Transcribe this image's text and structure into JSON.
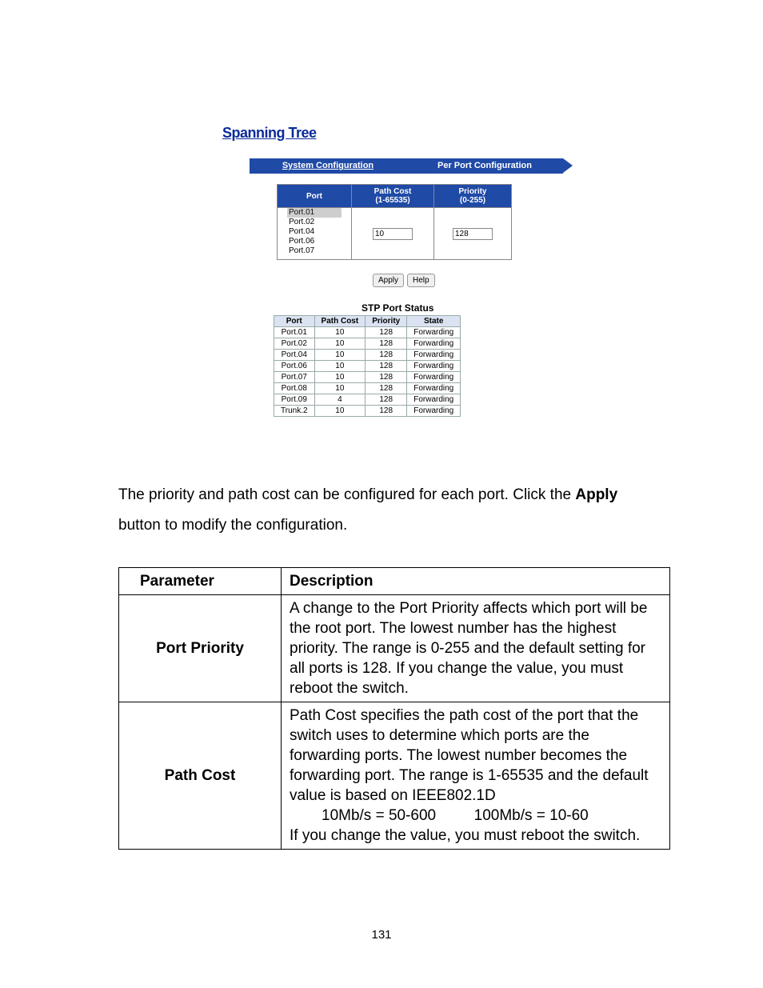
{
  "screenshot": {
    "title": "Spanning Tree",
    "tabs": {
      "system": "System Configuration",
      "per_port": "Per Port Configuration"
    },
    "config": {
      "headers": {
        "port": "Port",
        "path_cost": "Path Cost",
        "path_cost_range": "(1-65535)",
        "priority": "Priority",
        "priority_range": "(0-255)"
      },
      "port_options": [
        "Port.01",
        "Port.02",
        "Port.04",
        "Port.06",
        "Port.07"
      ],
      "path_cost_value": "10",
      "priority_value": "128"
    },
    "buttons": {
      "apply": "Apply",
      "help": "Help"
    },
    "status": {
      "title": "STP Port Status",
      "headers": {
        "port": "Port",
        "path_cost": "Path Cost",
        "priority": "Priority",
        "state": "State"
      },
      "rows": [
        {
          "port": "Port.01",
          "path_cost": "10",
          "priority": "128",
          "state": "Forwarding"
        },
        {
          "port": "Port.02",
          "path_cost": "10",
          "priority": "128",
          "state": "Forwarding"
        },
        {
          "port": "Port.04",
          "path_cost": "10",
          "priority": "128",
          "state": "Forwarding"
        },
        {
          "port": "Port.06",
          "path_cost": "10",
          "priority": "128",
          "state": "Forwarding"
        },
        {
          "port": "Port.07",
          "path_cost": "10",
          "priority": "128",
          "state": "Forwarding"
        },
        {
          "port": "Port.08",
          "path_cost": "10",
          "priority": "128",
          "state": "Forwarding"
        },
        {
          "port": "Port.09",
          "path_cost": "4",
          "priority": "128",
          "state": "Forwarding"
        },
        {
          "port": "Trunk.2",
          "path_cost": "10",
          "priority": "128",
          "state": "Forwarding"
        }
      ]
    }
  },
  "body_text": {
    "part1": "The priority and path cost can be configured for each port.   Click the ",
    "apply_bold": "Apply",
    "part2": " button to modify the configuration."
  },
  "desc_table": {
    "headers": {
      "parameter": "Parameter",
      "description": "Description"
    },
    "rows": [
      {
        "param": "Port Priority",
        "desc": "A change to the Port Priority affects which port will be the root port. The lowest number has the highest priority. The range is 0-255 and the default setting for all ports is 128.   If you change the value, you must reboot the switch."
      },
      {
        "param": "Path Cost",
        "desc_line1": "Path Cost specifies the path cost of the port that the switch uses to determine which ports are the forwarding ports.   The lowest number becomes the forwarding port.   The range is 1-65535 and the default value is based on IEEE802.1D",
        "desc_speeds": "10Mb/s = 50-600         100Mb/s = 10-60",
        "desc_line3": "If you change the value, you must reboot the switch."
      }
    ]
  },
  "page_number": "131"
}
